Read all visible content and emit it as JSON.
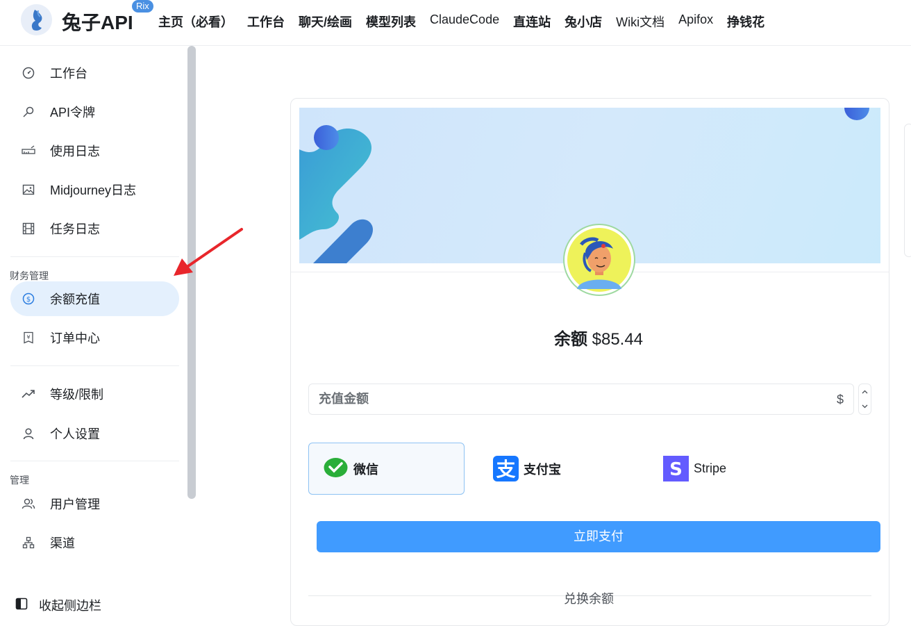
{
  "header": {
    "brand": "兔子API",
    "badge": "Rix",
    "nav": [
      {
        "label": "主页（必看）",
        "bold": true
      },
      {
        "label": "工作台",
        "bold": true
      },
      {
        "label": "聊天/绘画",
        "bold": true
      },
      {
        "label": "模型列表",
        "bold": true
      },
      {
        "label": "ClaudeCode",
        "bold": false
      },
      {
        "label": "直连站",
        "bold": true
      },
      {
        "label": "兔小店",
        "bold": true
      },
      {
        "label": "Wiki文档",
        "bold": false
      },
      {
        "label": "Apifox",
        "bold": false
      },
      {
        "label": "挣钱花",
        "bold": true
      }
    ]
  },
  "sidebar": {
    "items": [
      {
        "label": "工作台",
        "icon": "dashboard-icon"
      },
      {
        "label": "API令牌",
        "icon": "key-icon"
      },
      {
        "label": "使用日志",
        "icon": "log-icon"
      },
      {
        "label": "Midjourney日志",
        "icon": "image-icon"
      },
      {
        "label": "任务日志",
        "icon": "film-icon"
      }
    ],
    "finance_title": "财务管理",
    "finance_items": [
      {
        "label": "余额充值",
        "icon": "dollar-icon",
        "active": true
      },
      {
        "label": "订单中心",
        "icon": "yen-receipt-icon"
      }
    ],
    "misc_items": [
      {
        "label": "等级/限制",
        "icon": "trend-icon"
      },
      {
        "label": "个人设置",
        "icon": "user-icon"
      }
    ],
    "admin_title": "管理",
    "admin_items": [
      {
        "label": "用户管理",
        "icon": "users-icon"
      },
      {
        "label": "渠道",
        "icon": "channel-icon"
      }
    ],
    "collapse_label": "收起侧边栏"
  },
  "main": {
    "balance_label": "余额",
    "balance_value": "$85.44",
    "amount_placeholder": "充值金额",
    "amount_suffix": "$",
    "payment_methods": [
      {
        "label": "微信",
        "icon": "wechat-icon",
        "selected": true
      },
      {
        "label": "支付宝",
        "icon": "alipay-icon"
      },
      {
        "label": "Stripe",
        "icon": "stripe-icon"
      }
    ],
    "pay_button": "立即支付",
    "exchange_label": "兑换余额"
  },
  "colors": {
    "accent": "#409bff",
    "active_bg": "#e4f0fd",
    "arrow": "#e8262b"
  }
}
